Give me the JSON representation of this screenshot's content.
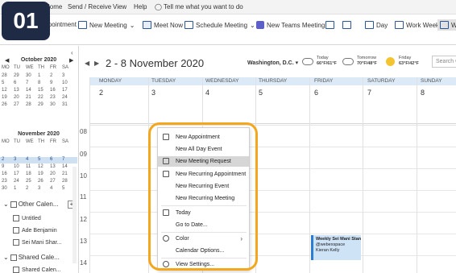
{
  "badge": "01",
  "menu": {
    "home": "Home",
    "send_receive": "Send / Receive",
    "view": "View",
    "help": "Help",
    "tell_me": "Tell me what you want to do"
  },
  "ribbon": {
    "new_appointment": "Appointment",
    "new_meeting": "New Meeting",
    "meet_now": "Meet Now",
    "schedule_meeting": "Schedule Meeting",
    "teams_meeting": "New Teams Meeting",
    "day": "Day",
    "work_week": "Work Week",
    "week_partial": "W"
  },
  "mini_cal_1": {
    "title": "October 2020",
    "dow": [
      "MO",
      "TU",
      "WE",
      "TH",
      "FR",
      "SA"
    ],
    "rows": [
      [
        "28",
        "29",
        "30",
        "1",
        "2",
        "3"
      ],
      [
        "5",
        "6",
        "7",
        "8",
        "9",
        "10"
      ],
      [
        "12",
        "13",
        "14",
        "15",
        "16",
        "17"
      ],
      [
        "19",
        "20",
        "21",
        "22",
        "23",
        "24"
      ],
      [
        "26",
        "27",
        "28",
        "29",
        "30",
        "31"
      ]
    ]
  },
  "mini_cal_2": {
    "title": "November 2020",
    "dow": [
      "MO",
      "TU",
      "WE",
      "TH",
      "FR",
      "SA"
    ],
    "rows": [
      [
        "2",
        "3",
        "4",
        "5",
        "6",
        "7"
      ],
      [
        "9",
        "10",
        "11",
        "12",
        "13",
        "14"
      ],
      [
        "16",
        "17",
        "18",
        "19",
        "20",
        "21"
      ],
      [
        "23",
        "24",
        "25",
        "26",
        "27",
        "28"
      ],
      [
        "30",
        "1",
        "2",
        "3",
        "4",
        "5"
      ]
    ]
  },
  "folders": {
    "other_calendars": "Other Calen...",
    "items": [
      "Untitled",
      "Ade Benjamin",
      "Sei Mani Shar..."
    ],
    "shared_calendars": "Shared Cale...",
    "shared_items": [
      "Shared Calen..."
    ]
  },
  "calendar": {
    "range": "2 - 8 November 2020",
    "location": "Washington, D.C.",
    "weather": [
      {
        "day": "Today",
        "temp": "66°F/61°F"
      },
      {
        "day": "Tomorrow",
        "temp": "70°F/48°F"
      },
      {
        "day": "Friday",
        "temp": "63°F/42°F"
      }
    ],
    "search_placeholder": "Search Ca",
    "days": [
      "MONDAY",
      "TUESDAY",
      "WEDNESDAY",
      "THURSDAY",
      "FRIDAY",
      "SATURDAY",
      "SUNDAY"
    ],
    "dates": [
      "2",
      "3",
      "4",
      "5",
      "6",
      "7",
      "8"
    ],
    "hours": [
      "08",
      "09",
      "10",
      "11",
      "12",
      "13",
      "14"
    ]
  },
  "appointment": {
    "title": "Weekly Sei Mani Stan",
    "location": "@webexspace",
    "organizer": "Kieran Kelly"
  },
  "context_menu": {
    "new_appointment": "New Appointment",
    "new_all_day": "New All Day Event",
    "new_meeting_request": "New Meeting Request",
    "new_recurring_appointment": "New Recurring Appointment",
    "new_recurring_event": "New Recurring Event",
    "new_recurring_meeting": "New Recurring Meeting",
    "today": "Today",
    "go_to_date": "Go to Date...",
    "color": "Color",
    "calendar_options": "Calendar Options...",
    "view_settings": "View Settings..."
  },
  "colors": {
    "accent": "#2b579a",
    "highlight_ring": "#f4a71d",
    "day_header": "#dceaf7"
  }
}
